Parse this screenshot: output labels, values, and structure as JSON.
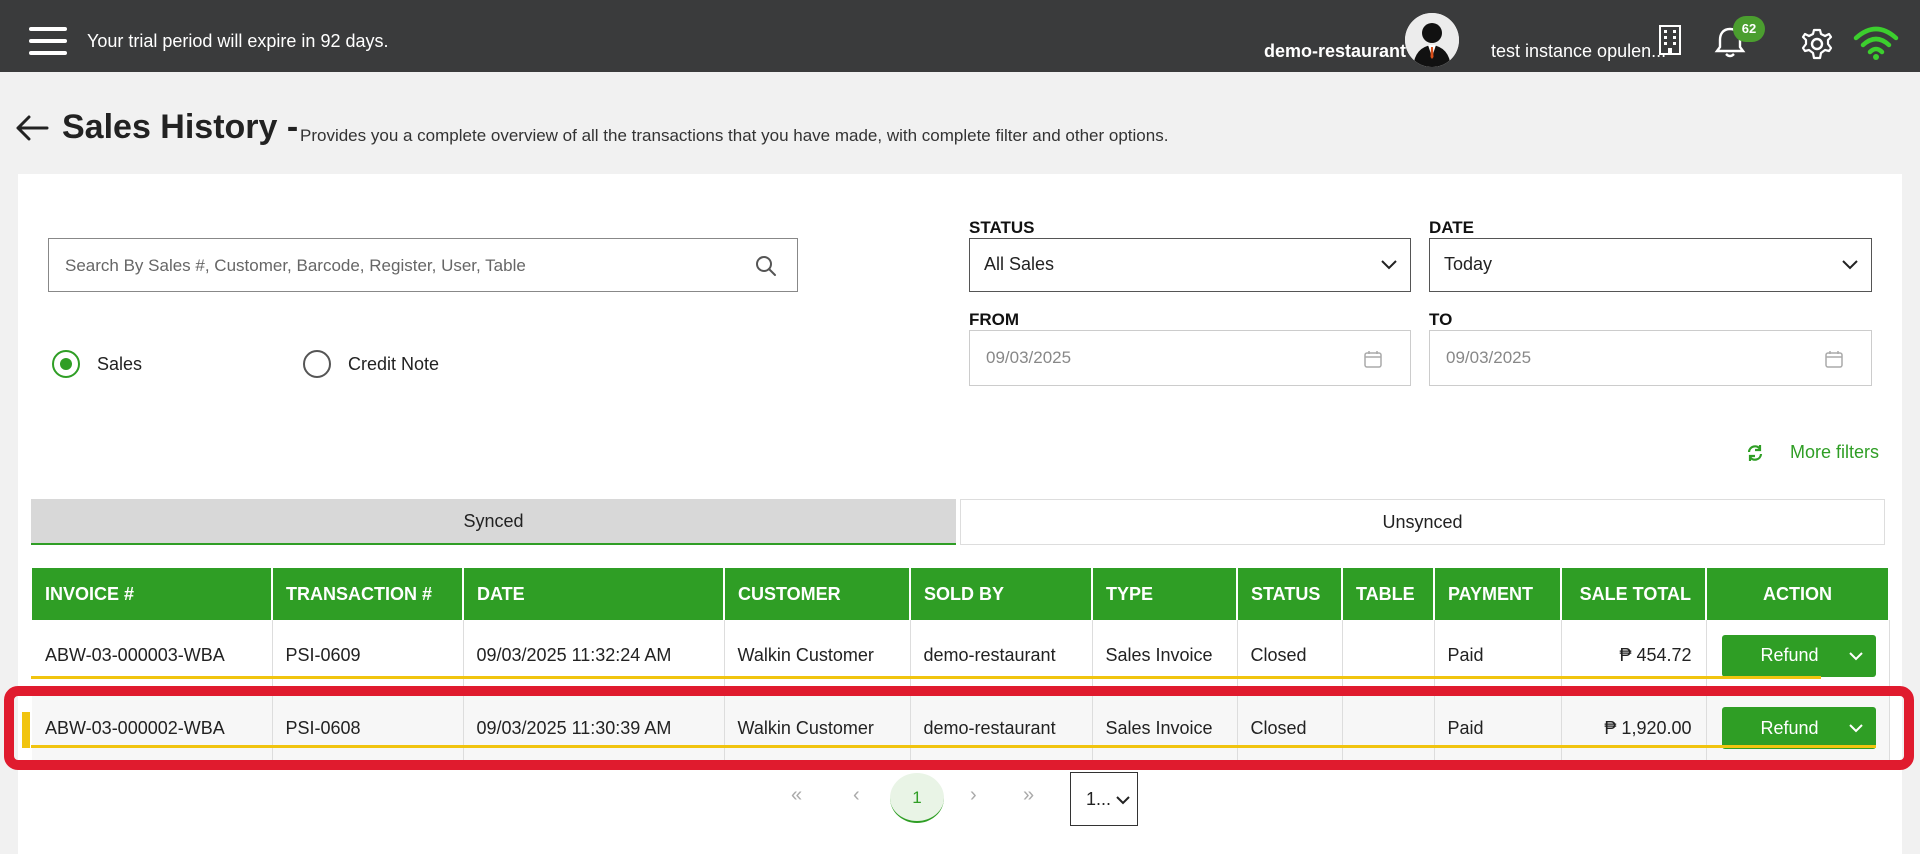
{
  "topbar": {
    "trial_text": "Your trial period will expire in 92 days.",
    "user_name": "demo-restaurant",
    "instance_name": "test instance opulen...",
    "notification_count": "62"
  },
  "header": {
    "title": "Sales History -",
    "subtitle": "Provides you a complete overview of all the transactions that you have made, with complete filter and other options."
  },
  "filters": {
    "search_placeholder": "Search By Sales #, Customer, Barcode, Register, User, Table",
    "radio_sales": "Sales",
    "radio_credit_note": "Credit Note",
    "selected_radio": "Sales",
    "status_label": "STATUS",
    "status_value": "All Sales",
    "date_label": "DATE",
    "date_value": "Today",
    "from_label": "FROM",
    "from_value": "09/03/2025",
    "to_label": "TO",
    "to_value": "09/03/2025",
    "more_filters": "More filters"
  },
  "tabs": [
    {
      "label": "Synced",
      "active": true
    },
    {
      "label": "Unsynced",
      "active": false
    }
  ],
  "table": {
    "columns": [
      "INVOICE #",
      "TRANSACTION #",
      "DATE",
      "CUSTOMER",
      "SOLD BY",
      "TYPE",
      "STATUS",
      "TABLE",
      "PAYMENT",
      "SALE TOTAL",
      "ACTION"
    ],
    "rows": [
      {
        "invoice": "ABW-03-000003-WBA",
        "transaction": "PSI-0609",
        "date": "09/03/2025 11:32:24 AM",
        "customer": "Walkin Customer",
        "sold_by": "demo-restaurant",
        "type": "Sales Invoice",
        "status": "Closed",
        "table": "",
        "payment": "Paid",
        "total": "₱ 454.72",
        "action": "Refund"
      },
      {
        "invoice": "ABW-03-000002-WBA",
        "transaction": "PSI-0608",
        "date": "09/03/2025 11:30:39 AM",
        "customer": "Walkin Customer",
        "sold_by": "demo-restaurant",
        "type": "Sales Invoice",
        "status": "Closed",
        "table": "",
        "payment": "Paid",
        "total": "₱ 1,920.00",
        "action": "Refund"
      }
    ]
  },
  "pagination": {
    "current_page": "1",
    "page_size": "1..."
  },
  "colors": {
    "accent": "#2f9e25",
    "topbar": "#3a3b3c",
    "highlight": "#e01b2e",
    "row_marker": "#f1c40f"
  }
}
